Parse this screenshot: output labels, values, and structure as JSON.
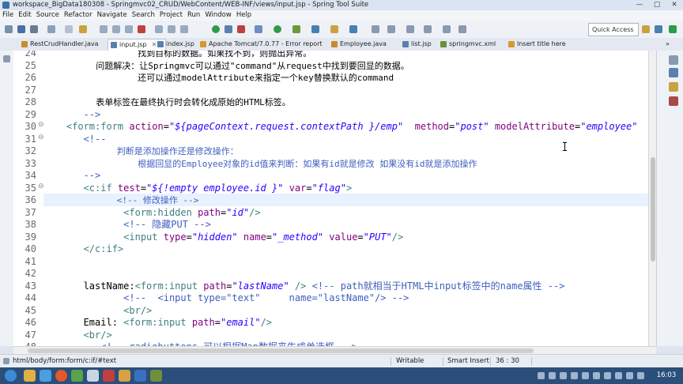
{
  "window": {
    "title": "workspace_BigData180308 - Springmvc02_CRUD/WebContent/WEB-INF/views/input.jsp - Spring Tool Suite"
  },
  "menu": [
    "File",
    "Edit",
    "Source",
    "Refactor",
    "Navigate",
    "Search",
    "Project",
    "Run",
    "Window",
    "Help"
  ],
  "toolbar": {
    "quick_access": "Quick Access"
  },
  "tabs": [
    {
      "label": "RestCrudHandler.java",
      "icon": "java-file-icon",
      "color": "#c88a2b"
    },
    {
      "label": "input.jsp",
      "icon": "jsp-file-icon",
      "color": "#5b7fb0",
      "active": true,
      "closable": true
    },
    {
      "label": "index.jsp",
      "icon": "jsp-file-icon",
      "color": "#5b7fb0"
    },
    {
      "label": "Apache Tomcat/7.0.77 - Error report",
      "icon": "browser-icon",
      "color": "#d49a2a"
    },
    {
      "label": "Employee.java",
      "icon": "java-file-icon",
      "color": "#c88a2b"
    },
    {
      "label": "list.jsp",
      "icon": "jsp-file-icon",
      "color": "#5b7fb0"
    },
    {
      "label": "springmvc.xml",
      "icon": "xml-file-icon",
      "color": "#6f8f3a"
    },
    {
      "label": "Insert title here",
      "icon": "browser-icon",
      "color": "#d49a2a"
    }
  ],
  "editor": {
    "current_line": 36,
    "lines": [
      {
        "n": "24",
        "cn": true,
        "parts": [
          [
            "t",
            "                  找到目标的数据。如果找不到，则抛出异常。"
          ]
        ]
      },
      {
        "n": "25",
        "cn": true,
        "parts": [
          [
            "t",
            "          问题解决：让Springmvc可以通过\"command\"从request中找到要回显的数据。"
          ]
        ]
      },
      {
        "n": "26",
        "cn": true,
        "parts": [
          [
            "t",
            "                  还可以通过modelAttribute来指定一个key替换默认的command"
          ]
        ]
      },
      {
        "n": "27",
        "parts": []
      },
      {
        "n": "28",
        "cn": true,
        "parts": [
          [
            "t",
            "          表单标签在最终执行时会转化成原始的HTML标签。"
          ]
        ]
      },
      {
        "n": "29",
        "parts": [
          [
            "c",
            "       -->"
          ]
        ]
      },
      {
        "n": "30",
        "parts": [
          [
            "g",
            "    <form:form "
          ],
          [
            "a",
            "action"
          ],
          [
            "t",
            "="
          ],
          [
            "v",
            "\"${pageContext.request.contextPath }/emp\""
          ],
          [
            "t",
            "  "
          ],
          [
            "a",
            "method"
          ],
          [
            "t",
            "="
          ],
          [
            "v",
            "\"post\""
          ],
          [
            "t",
            " "
          ],
          [
            "a",
            "modelAttribute"
          ],
          [
            "t",
            "="
          ],
          [
            "v",
            "\"employee\""
          ]
        ]
      },
      {
        "n": "31",
        "parts": [
          [
            "c",
            "       <!--"
          ]
        ]
      },
      {
        "n": "32",
        "cn": true,
        "parts": [
          [
            "c",
            "              判断是添加操作还是修改操作："
          ]
        ]
      },
      {
        "n": "33",
        "cn": true,
        "parts": [
          [
            "c",
            "                  根据回显的Employee对象的id值来判断：如果有id就是修改 如果没有id就是添加操作"
          ]
        ]
      },
      {
        "n": "34",
        "parts": [
          [
            "c",
            "       -->"
          ]
        ]
      },
      {
        "n": "35",
        "parts": [
          [
            "g",
            "       <c:if "
          ],
          [
            "a",
            "test"
          ],
          [
            "t",
            "="
          ],
          [
            "v",
            "\"${!empty employee.id }\""
          ],
          [
            "t",
            " "
          ],
          [
            "a",
            "var"
          ],
          [
            "t",
            "="
          ],
          [
            "v",
            "\"flag\""
          ],
          [
            "g",
            ">"
          ]
        ]
      },
      {
        "n": "36",
        "cn": true,
        "parts": [
          [
            "c",
            "              <!-- 修改操作 -->"
          ]
        ]
      },
      {
        "n": "37",
        "parts": [
          [
            "g",
            "              <form:hidden "
          ],
          [
            "a",
            "path"
          ],
          [
            "t",
            "="
          ],
          [
            "v",
            "\"id\""
          ],
          [
            "g",
            "/>"
          ]
        ]
      },
      {
        "n": "38",
        "parts": [
          [
            "c",
            "              <!-- 隐藏PUT -->"
          ]
        ]
      },
      {
        "n": "39",
        "parts": [
          [
            "g",
            "              <input "
          ],
          [
            "a",
            "type"
          ],
          [
            "t",
            "="
          ],
          [
            "v",
            "\"hidden\""
          ],
          [
            "t",
            " "
          ],
          [
            "a",
            "name"
          ],
          [
            "t",
            "="
          ],
          [
            "v",
            "\"_method\""
          ],
          [
            "t",
            " "
          ],
          [
            "a",
            "value"
          ],
          [
            "t",
            "="
          ],
          [
            "v",
            "\"PUT\""
          ],
          [
            "g",
            "/>"
          ]
        ]
      },
      {
        "n": "40",
        "parts": [
          [
            "g",
            "       </c:if>"
          ]
        ]
      },
      {
        "n": "41",
        "parts": []
      },
      {
        "n": "42",
        "parts": []
      },
      {
        "n": "43",
        "parts": [
          [
            "t",
            "       lastName:"
          ],
          [
            "g",
            "<form:input "
          ],
          [
            "a",
            "path"
          ],
          [
            "t",
            "="
          ],
          [
            "v",
            "\"lastName\""
          ],
          [
            "g",
            " />"
          ],
          [
            "t",
            " "
          ],
          [
            "c",
            "<!-- path就相当于HTML中input标签中的name属性 -->"
          ]
        ]
      },
      {
        "n": "44",
        "parts": [
          [
            "c",
            "              <!--  <input type=\"text\"     name=\"lastName\"/> -->"
          ]
        ]
      },
      {
        "n": "45",
        "parts": [
          [
            "g",
            "              <br/>"
          ]
        ]
      },
      {
        "n": "46",
        "parts": [
          [
            "t",
            "       Email: "
          ],
          [
            "g",
            "<form:input "
          ],
          [
            "a",
            "path"
          ],
          [
            "t",
            "="
          ],
          [
            "v",
            "\"email\""
          ],
          [
            "g",
            "/>"
          ]
        ]
      },
      {
        "n": "47",
        "parts": [
          [
            "g",
            "       <br/>"
          ]
        ]
      },
      {
        "n": "48",
        "parts": [
          [
            "c",
            "          <!-- radiobuttons 可以根据Map数据来生成单选框 -->"
          ]
        ]
      }
    ]
  },
  "status": {
    "path": "html/body/form:form/c:if/#text",
    "mode": "Writable",
    "insert": "Smart Insert",
    "position": "36 : 30"
  },
  "taskbar": {
    "time": "16:03"
  }
}
